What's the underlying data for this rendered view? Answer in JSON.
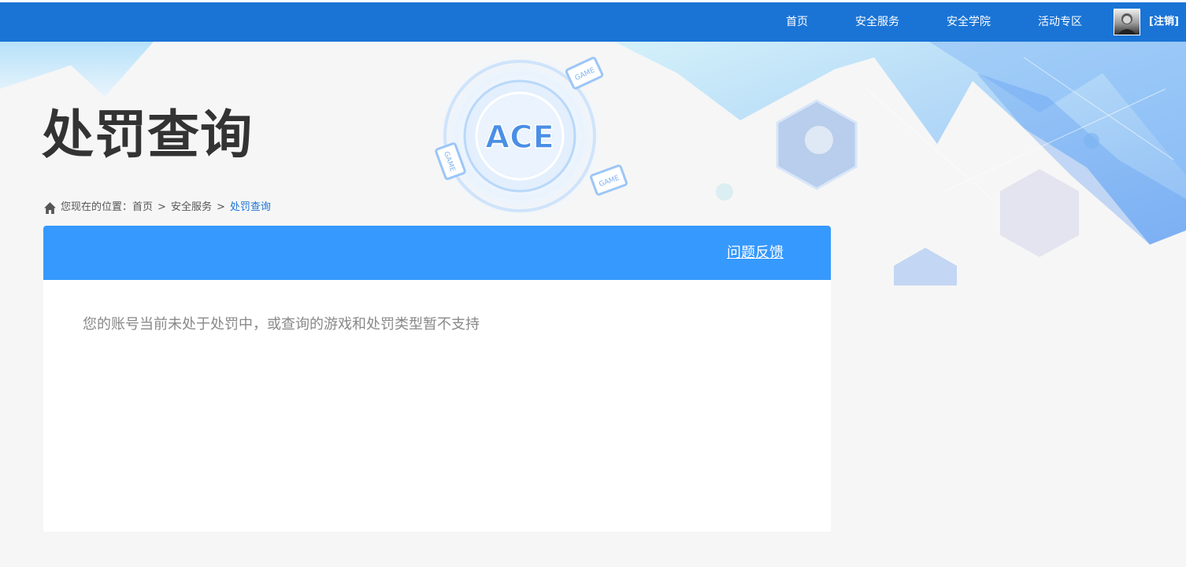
{
  "nav": {
    "items": [
      {
        "label": "首页"
      },
      {
        "label": "安全服务"
      },
      {
        "label": "安全学院"
      },
      {
        "label": "活动专区"
      }
    ],
    "logout_label": "[注销]",
    "bg_color": "#1a74d6"
  },
  "banner": {
    "logo_text": "ACE",
    "device_labels": [
      "GAME",
      "GAME",
      "GAME"
    ]
  },
  "page": {
    "title": "处罚查询"
  },
  "breadcrumb": {
    "prefix": "您现在的位置：",
    "items": [
      "首页",
      "安全服务"
    ],
    "separator": ">",
    "current": "处罚查询",
    "current_color": "#1a74d6"
  },
  "panel": {
    "header_color": "#3699fe",
    "feedback_label": "问题反馈",
    "message": "您的账号当前未处于处罚中，或查询的游戏和处罚类型暂不支持"
  }
}
